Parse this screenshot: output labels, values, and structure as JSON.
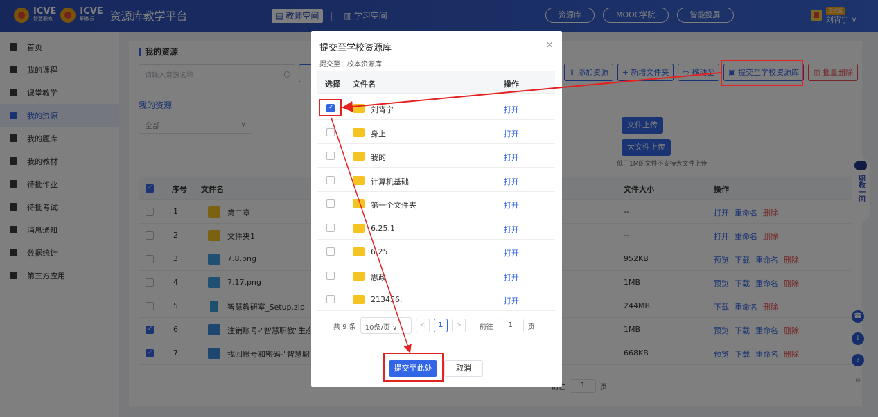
{
  "brand": {
    "name1": "ICVE",
    "sub1": "智慧职教",
    "name2": "ICVE",
    "sub2": "职教云",
    "platform": "资源库教学平台"
  },
  "topnav": {
    "teacher": "教师空间",
    "sep": "|",
    "learn": "学习空间"
  },
  "pills": [
    "资源库",
    "MOOC学院",
    "智能投屏"
  ],
  "user": {
    "tag": "正式版",
    "name": "刘宵宁 ∨"
  },
  "sidebar": [
    {
      "label": "首页"
    },
    {
      "label": "我的课程"
    },
    {
      "label": "课堂教学"
    },
    {
      "label": "我的资源"
    },
    {
      "label": "我的题库"
    },
    {
      "label": "我的教材"
    },
    {
      "label": "待批作业"
    },
    {
      "label": "待批考试"
    },
    {
      "label": "消息通知"
    },
    {
      "label": "数据统计"
    },
    {
      "label": "第三方应用"
    }
  ],
  "main": {
    "title": "我的资源",
    "search_placeholder": "请输入资源名称",
    "toolbar": [
      "添加资源",
      "新增文件夹",
      "移动至",
      "提交至学校资源库",
      "批量删除"
    ],
    "folder_title": "我的资源",
    "folder_select": "全部",
    "upload": "文件上传",
    "big_upload": "大文件上传",
    "upload_tip": "低于1M的文件不支持大文件上传",
    "headers": {
      "no": "序号",
      "name": "文件名",
      "size": "文件大小",
      "ops": "操作"
    },
    "rows": [
      {
        "no": "1",
        "name": "第二章",
        "type": "folder",
        "size": "--",
        "ops": [
          "打开",
          "重命名",
          "删除"
        ],
        "checked": false
      },
      {
        "no": "2",
        "name": "文件夹1",
        "type": "folder",
        "size": "--",
        "ops": [
          "打开",
          "重命名",
          "删除"
        ],
        "checked": false
      },
      {
        "no": "3",
        "name": "7.8.png",
        "type": "img",
        "size": "952KB",
        "ops": [
          "预览",
          "下载",
          "重命名",
          "删除"
        ],
        "checked": false
      },
      {
        "no": "4",
        "name": "7.17.png",
        "type": "img",
        "size": "1MB",
        "ops": [
          "预览",
          "下载",
          "重命名",
          "删除"
        ],
        "checked": false
      },
      {
        "no": "5",
        "name": "智慧教研室_Setup.zip",
        "type": "zip",
        "size": "244MB",
        "ops": [
          "下载",
          "重命名",
          "删除"
        ],
        "checked": false
      },
      {
        "no": "6",
        "name": "注销账号-\"智慧职教\"生态系统",
        "type": "pdf",
        "size": "1MB",
        "ops": [
          "预览",
          "下载",
          "重命名",
          "删除"
        ],
        "checked": true
      },
      {
        "no": "7",
        "name": "找回账号和密码-\"智慧职教\"生",
        "type": "pdf",
        "size": "668KB",
        "ops": [
          "预览",
          "下载",
          "重命名",
          "删除"
        ],
        "checked": true
      }
    ],
    "pager_goto": "前往",
    "pager_page": "1",
    "pager_unit": "页"
  },
  "dialog": {
    "title": "提交至学校资源库",
    "close": "×",
    "sub": "提交至：校本资源库",
    "headers": {
      "select": "选择",
      "name": "文件名",
      "ops": "操作"
    },
    "rows": [
      {
        "name": "刘宵宁",
        "op": "打开",
        "checked": true
      },
      {
        "name": "身上",
        "op": "打开",
        "checked": false
      },
      {
        "name": "我的",
        "op": "打开",
        "checked": false
      },
      {
        "name": "计算机基础",
        "op": "打开",
        "checked": false
      },
      {
        "name": "第一个文件夹",
        "op": "打开",
        "checked": false
      },
      {
        "name": "6.25.1",
        "op": "打开",
        "checked": false
      },
      {
        "name": "6.25",
        "op": "打开",
        "checked": false
      },
      {
        "name": "思政",
        "op": "打开",
        "checked": false
      },
      {
        "name": "213456.",
        "op": "打开",
        "checked": false
      }
    ],
    "pager": {
      "total": "共 9 条",
      "size": "10条/页",
      "prev": "<",
      "page": "1",
      "next": ">",
      "goto": "前往",
      "input": "1",
      "unit": "页"
    },
    "ok": "提交至此处",
    "cancel": "取消"
  },
  "robot": "职教一问",
  "colors": {
    "primary": "#3366e6",
    "annotation": "#e32222",
    "danger": "#e84b4b"
  }
}
